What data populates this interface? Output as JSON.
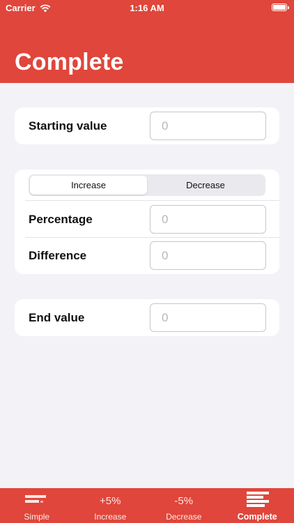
{
  "status_bar": {
    "carrier": "Carrier",
    "time": "1:16 AM"
  },
  "header": {
    "title": "Complete"
  },
  "starting": {
    "label": "Starting value",
    "placeholder": "0"
  },
  "change": {
    "segments": [
      "Increase",
      "Decrease"
    ],
    "selected": "Increase",
    "percentage": {
      "label": "Percentage",
      "placeholder": "0"
    },
    "difference": {
      "label": "Difference",
      "placeholder": "0"
    }
  },
  "end": {
    "label": "End value",
    "placeholder": "0"
  },
  "tabs": [
    {
      "label": "Simple",
      "icon": "simple-bars-icon"
    },
    {
      "label": "Increase",
      "glyph": "+5%"
    },
    {
      "label": "Decrease",
      "glyph": "-5%"
    },
    {
      "label": "Complete",
      "icon": "complete-list-icon"
    }
  ],
  "colors": {
    "accent": "#e0463b",
    "background": "#f2f2f7"
  }
}
